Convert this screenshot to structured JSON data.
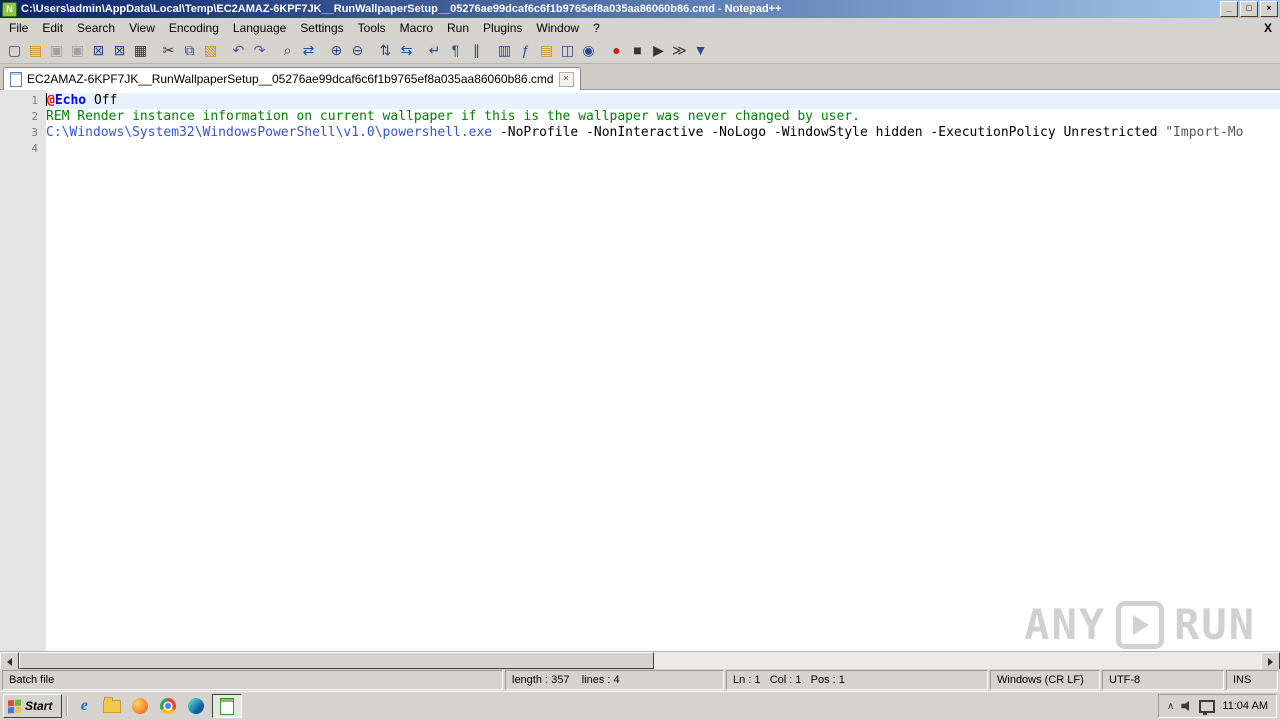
{
  "colors": {
    "titlebar_start": "#0a246a",
    "titlebar_end": "#a6caf0",
    "chrome_bg": "#d6d3ce",
    "editor_bg": "#ffffff",
    "gutter_bg": "#e4e4e4",
    "gutter_fg": "#808080",
    "current_line_bg": "#e8f2fe",
    "comment_green": "#008000",
    "keyword_blue": "#0000ff",
    "at_red": "#ff0000",
    "path_blue": "#3355cc",
    "string_color": "#555555",
    "plain_color": "#000000"
  },
  "window": {
    "icon_glyph": "N",
    "title": "C:\\Users\\admin\\AppData\\Local\\Temp\\EC2AMAZ-6KPF7JK__RunWallpaperSetup__05276ae99dcaf6c6f1b9765ef8a035aa86060b86.cmd - Notepad++",
    "minimize_label": "_",
    "maximize_label": "□",
    "close_label": "×"
  },
  "menu": {
    "items": [
      "File",
      "Edit",
      "Search",
      "View",
      "Encoding",
      "Language",
      "Settings",
      "Tools",
      "Macro",
      "Run",
      "Plugins",
      "Window",
      "?"
    ],
    "right_close_label": "X"
  },
  "toolbar": {
    "items": [
      {
        "name": "new-file",
        "glyph": "▢"
      },
      {
        "name": "open-file",
        "glyph": "▤"
      },
      {
        "name": "save",
        "glyph": "▣",
        "disabled": true
      },
      {
        "name": "save-all",
        "glyph": "▣",
        "disabled": true
      },
      {
        "name": "close-file",
        "glyph": "⊠"
      },
      {
        "name": "close-all",
        "glyph": "⊠"
      },
      {
        "name": "print",
        "glyph": "▦"
      },
      {
        "name": "cut",
        "glyph": "✂"
      },
      {
        "name": "copy",
        "glyph": "⧉"
      },
      {
        "name": "paste",
        "glyph": "▧"
      },
      {
        "name": "undo",
        "glyph": "↶"
      },
      {
        "name": "redo",
        "glyph": "↷"
      },
      {
        "name": "find",
        "glyph": "⌕"
      },
      {
        "name": "replace",
        "glyph": "⇄"
      },
      {
        "name": "zoom-in",
        "glyph": "⊕"
      },
      {
        "name": "zoom-out",
        "glyph": "⊖"
      },
      {
        "name": "sync-vertical-scroll",
        "glyph": "⇅"
      },
      {
        "name": "sync-horizontal-scroll",
        "glyph": "⇆"
      },
      {
        "name": "word-wrap",
        "glyph": "↵"
      },
      {
        "name": "show-all-characters",
        "glyph": "¶"
      },
      {
        "name": "show-indent-guide",
        "glyph": "∥"
      },
      {
        "name": "document-map",
        "glyph": "▥"
      },
      {
        "name": "function-list",
        "glyph": "ƒ"
      },
      {
        "name": "folder-as-workspace",
        "glyph": "▤"
      },
      {
        "name": "document-switcher",
        "glyph": "◫"
      },
      {
        "name": "monitoring",
        "glyph": "◉"
      },
      {
        "name": "start-recording",
        "glyph": "●"
      },
      {
        "name": "stop-recording",
        "glyph": "■"
      },
      {
        "name": "playback-macro",
        "glyph": "▶"
      },
      {
        "name": "run-macro-multiple-times",
        "glyph": "≫"
      },
      {
        "name": "save-recorded-macro",
        "glyph": "▼"
      }
    ]
  },
  "tabbar": {
    "tabs": [
      {
        "label": "EC2AMAZ-6KPF7JK__RunWallpaperSetup__05276ae99dcaf6c6f1b9765ef8a035aa86060b86.cmd"
      }
    ],
    "close_glyph": "×"
  },
  "editor": {
    "current_line": 1,
    "lines": [
      {
        "number": "1",
        "segments": [
          {
            "text": "@"
          },
          {
            "text": "Echo"
          },
          {
            "text": " Off"
          }
        ]
      },
      {
        "number": "2",
        "segments": [
          {
            "text": "REM Render instance information on current wallpaper if this is the wallpaper was never changed by user."
          }
        ]
      },
      {
        "number": "3",
        "segments": [
          {
            "text": "C:\\Windows\\System32\\WindowsPowerShell\\v1.0\\powershell.exe"
          },
          {
            "text": " -NoProfile -NonInteractive -NoLogo -WindowStyle hidden -ExecutionPolicy Unrestricted "
          },
          {
            "text": "\"Import-Mo"
          }
        ]
      },
      {
        "number": "4",
        "segments": []
      }
    ]
  },
  "statusbar": {
    "doc_type": "Batch file",
    "length_info": "length : 357    lines : 4",
    "cursor_info": "Ln : 1   Col : 1   Pos : 1",
    "eol_format": "Windows (CR LF)",
    "encoding": "UTF-8",
    "insert_mode": "INS"
  },
  "taskbar": {
    "start_label": "Start",
    "quick_launch": [
      {
        "name": "internet-explorer",
        "glyph": "e"
      },
      {
        "name": "file-explorer",
        "glyph": ""
      },
      {
        "name": "firefox",
        "glyph": ""
      },
      {
        "name": "chrome",
        "glyph": ""
      },
      {
        "name": "edge",
        "glyph": ""
      }
    ],
    "active_task": "notepad-plus-plus",
    "tray_chevron_glyph": "∧",
    "clock": "11:04 AM"
  },
  "watermark": {
    "left": "ANY",
    "right": "RUN"
  }
}
